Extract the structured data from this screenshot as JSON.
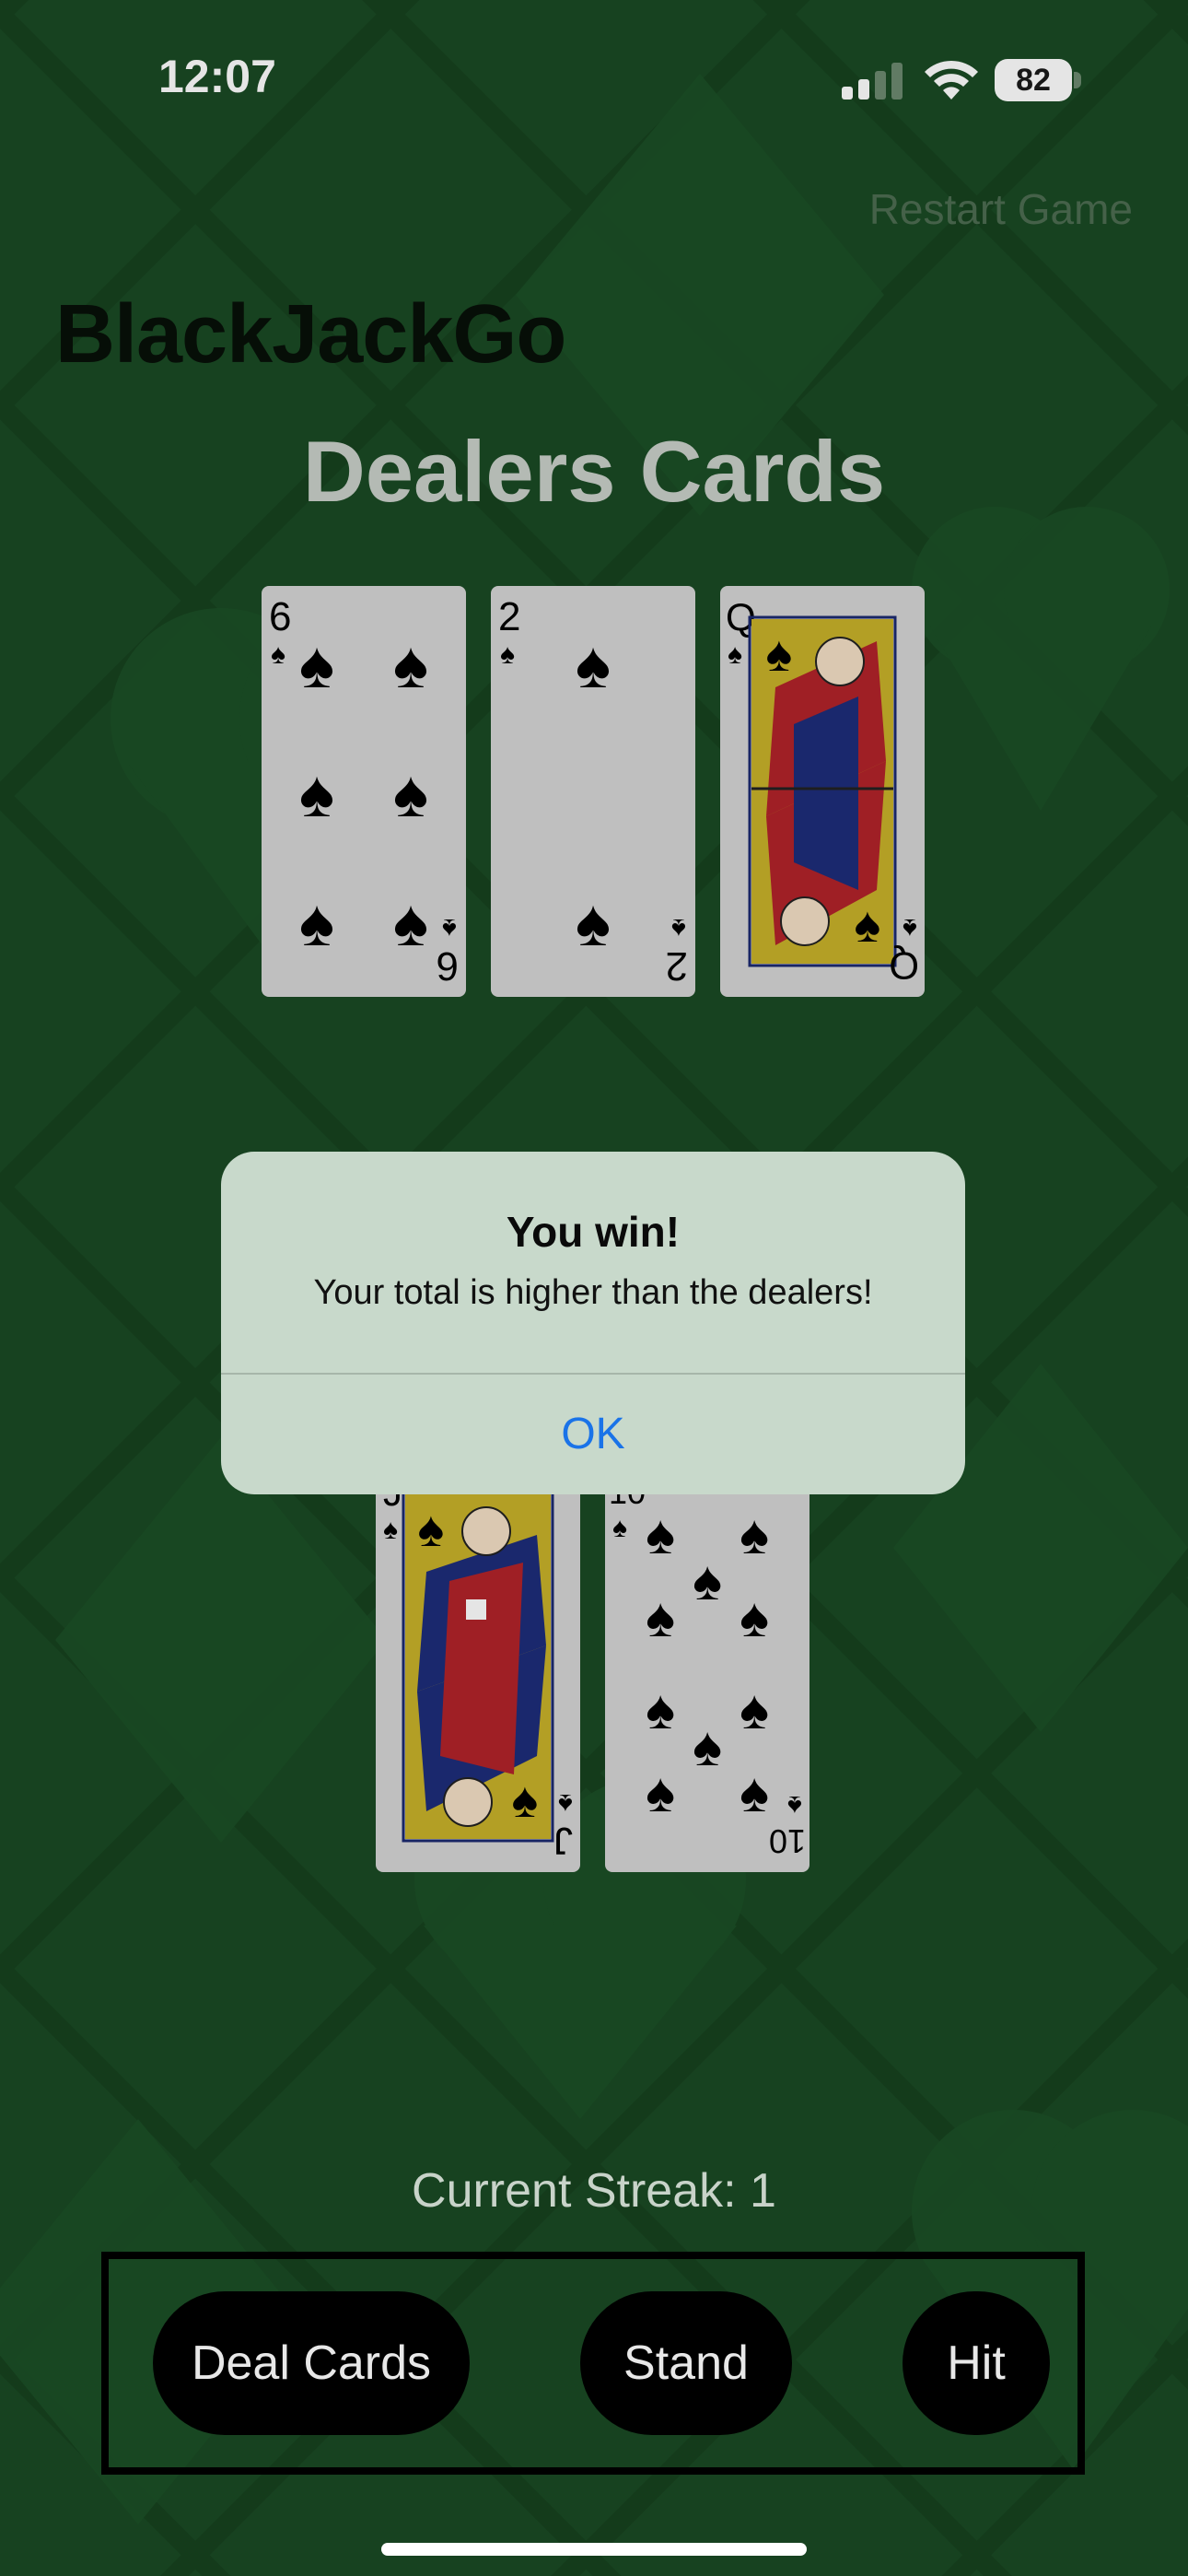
{
  "status_bar": {
    "time": "12:07",
    "battery": "82",
    "icons": [
      "cellular-signal-icon",
      "wifi-icon",
      "battery-icon"
    ]
  },
  "header": {
    "restart_label": "Restart Game",
    "app_title": "BlackJackGo"
  },
  "dealer": {
    "title": "Dealers Cards",
    "cards": [
      {
        "rank": "6",
        "suit": "spades"
      },
      {
        "rank": "2",
        "suit": "spades"
      },
      {
        "rank": "Q",
        "suit": "spades"
      }
    ]
  },
  "player": {
    "cards": [
      {
        "rank": "J",
        "suit": "spades"
      },
      {
        "rank": "10",
        "suit": "spades"
      }
    ]
  },
  "alert": {
    "title": "You win!",
    "message": "Your total is higher than the dealers!",
    "ok_label": "OK"
  },
  "streak": {
    "label": "Current Streak: 1"
  },
  "actions": {
    "deal_label": "Deal Cards",
    "stand_label": "Stand",
    "hit_label": "Hit"
  },
  "colors": {
    "felt": "#1a4a24",
    "alert_bg": "#c8d9cb",
    "link_blue": "#1a73e8"
  }
}
